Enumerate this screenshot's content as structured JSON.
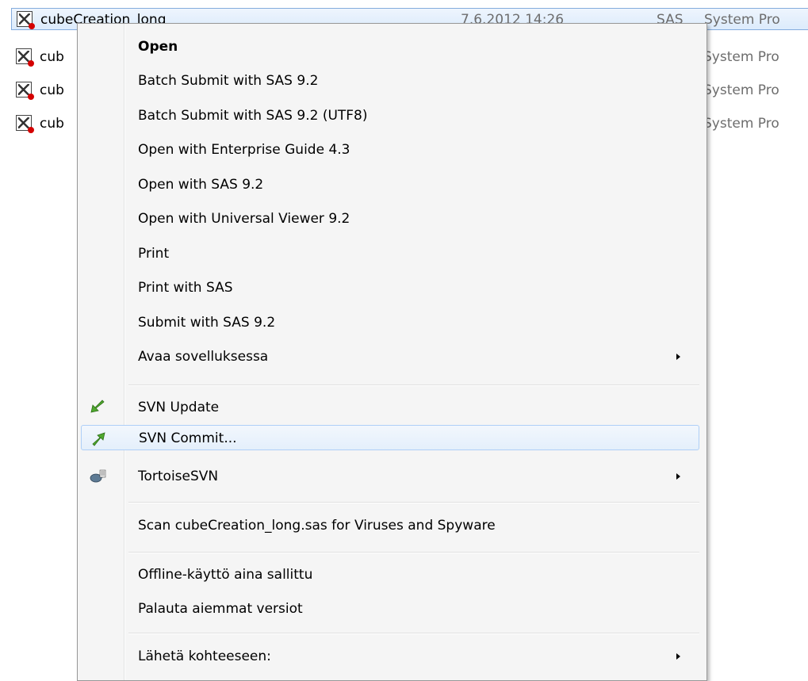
{
  "files": [
    {
      "name": "cubeCreation_long",
      "date": "7.6.2012 14:26",
      "type_prefix": "SAS",
      "type": "System Pro"
    },
    {
      "name": "cub",
      "type": "System Pro"
    },
    {
      "name": "cub",
      "type": "System Pro"
    },
    {
      "name": "cub",
      "type": "System Pro"
    }
  ],
  "menu": {
    "open": "Open",
    "batch_submit": "Batch Submit with SAS 9.2",
    "batch_submit_utf8": "Batch Submit with SAS 9.2 (UTF8)",
    "open_eg": "Open with Enterprise Guide 4.3",
    "open_sas": "Open with SAS 9.2",
    "open_uv": "Open with Universal Viewer 9.2",
    "print": "Print",
    "print_sas": "Print with SAS",
    "submit_sas": "Submit with SAS 9.2",
    "open_with": "Avaa sovelluksessa",
    "svn_update": "SVN Update",
    "svn_commit": "SVN Commit...",
    "tortoise": "TortoiseSVN",
    "scan": "Scan cubeCreation_long.sas for Viruses and Spyware",
    "offline": "Offline-käyttö aina sallittu",
    "restore": "Palauta aiemmat versiot",
    "send_to": "Lähetä kohteeseen:"
  },
  "icons": {
    "svn_update": "svn-update-arrow-icon",
    "svn_commit": "svn-commit-arrow-icon",
    "tortoise": "tortoisesvn-icon",
    "file": "sas-program-file-icon"
  },
  "colors": {
    "menu_bg": "#f5f5f5",
    "selection_border": "#84acdd",
    "hover_border": "#aecff7",
    "svn_green": "#4fa82e"
  }
}
